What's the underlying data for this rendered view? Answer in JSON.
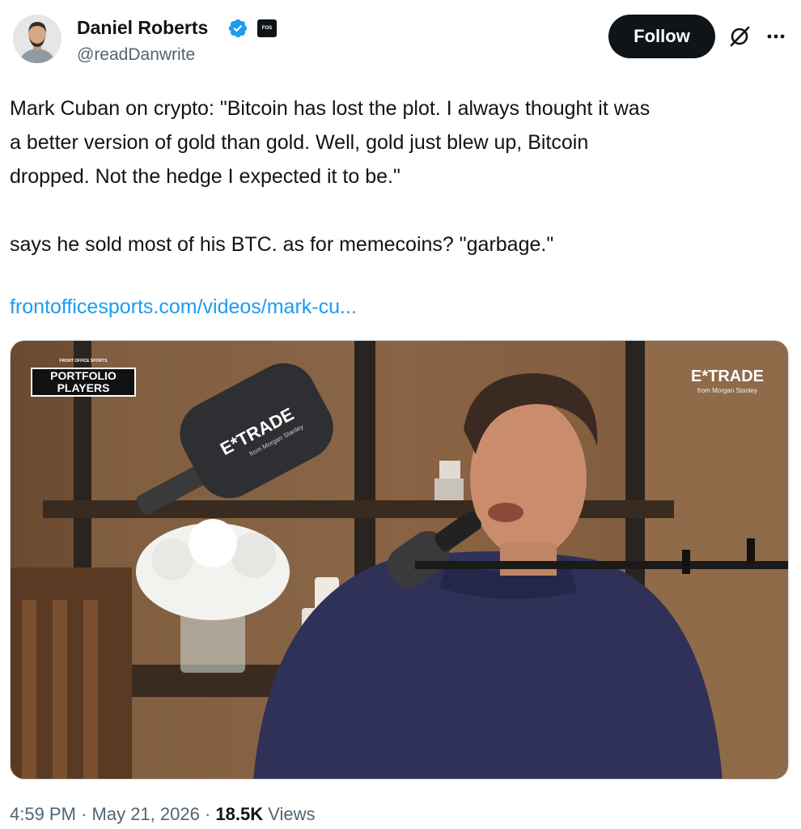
{
  "author": {
    "name": "Daniel Roberts",
    "handle": "@readDanwrite",
    "verified": true,
    "affiliate_badge_text": "FOS"
  },
  "actions": {
    "follow_label": "Follow",
    "grok_icon": "grok-icon",
    "more_icon": "more-icon"
  },
  "tweet": {
    "text": "Mark Cuban on crypto: \"Bitcoin has lost the plot. I always thought it was\na better version of gold than gold. Well, gold just blew up, Bitcoin\ndropped. Not the hedge I expected it to be.\"\n\nsays he sold most of his BTC. as for memecoins? \"garbage.\"",
    "link": "frontofficesports.com/videos/mark-cu..."
  },
  "media": {
    "overlay_top_small": "FRONT OFFICE SPORTS",
    "overlay_title_line1": "PORTFOLIO",
    "overlay_title_line2": "PLAYERS",
    "sponsor_logo": "E*TRADE",
    "sponsor_sub": "from Morgan Stanley",
    "paddle_logo": "E*TRADE",
    "paddle_sub": "from Morgan Stanley"
  },
  "meta": {
    "time": "4:59 PM",
    "sep1": "·",
    "date": "May 21, 2026",
    "sep2": "·",
    "views_count": "18.5K",
    "views_label": "Views"
  },
  "colors": {
    "accent": "#1d9bf0",
    "text": "#0f1419",
    "secondary": "#536471",
    "follow_bg": "#0f1419"
  }
}
